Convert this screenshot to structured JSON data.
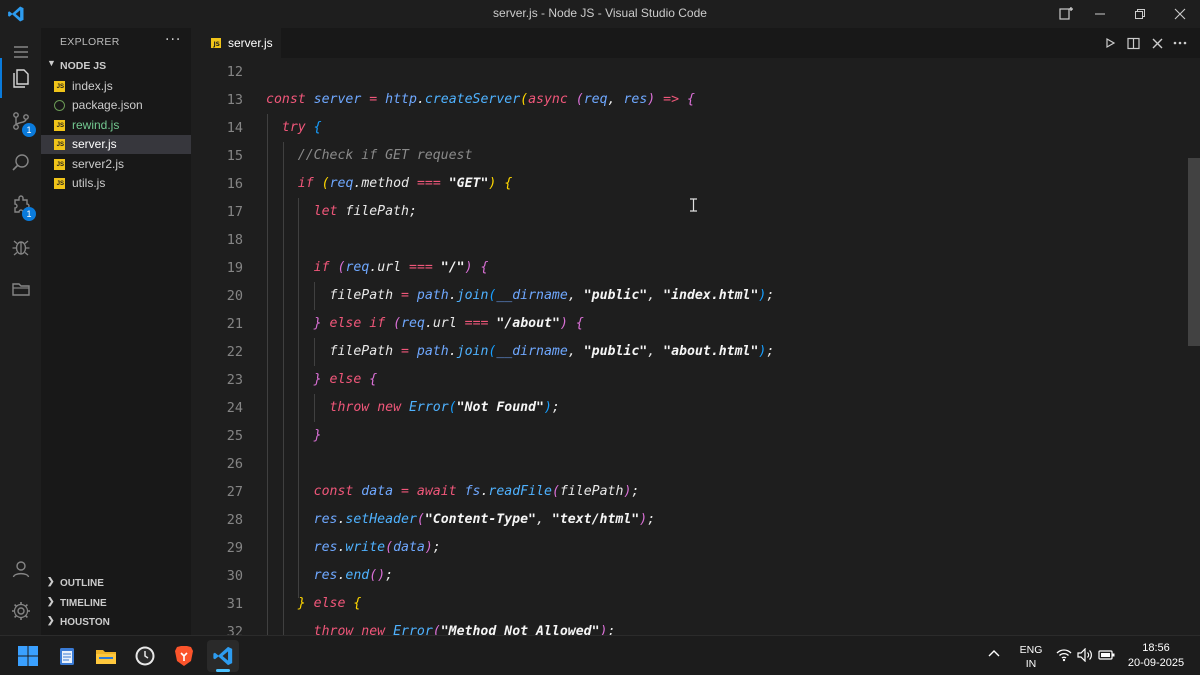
{
  "window": {
    "title": "server.js - Node JS - Visual Studio Code"
  },
  "activity_badges": {
    "scm": "1",
    "extensions": "1"
  },
  "sidebar": {
    "header": "EXPLORER",
    "more": "···",
    "folder": "NODE JS",
    "files": [
      {
        "name": "index.js",
        "icon": "js-icon",
        "color": "#cccccc"
      },
      {
        "name": "package.json",
        "icon": "json-icon",
        "color": "#cccccc"
      },
      {
        "name": "rewind.js",
        "icon": "js-icon",
        "color": "#73c991"
      },
      {
        "name": "server.js",
        "icon": "js-icon",
        "color": "#ffffff"
      },
      {
        "name": "server2.js",
        "icon": "js-icon",
        "color": "#cccccc"
      },
      {
        "name": "utils.js",
        "icon": "js-icon",
        "color": "#cccccc"
      }
    ],
    "sections": [
      "OUTLINE",
      "TIMELINE",
      "HOUSTON"
    ]
  },
  "tab": {
    "name": "server.js"
  },
  "editor": {
    "line_numbers": [
      "12",
      "13",
      "14",
      "15",
      "16",
      "17",
      "18",
      "19",
      "20",
      "21",
      "22",
      "23",
      "24",
      "25",
      "26",
      "27",
      "28",
      "29",
      "30",
      "31",
      "32"
    ]
  },
  "taskbar": {
    "language": "ENG",
    "region": "IN",
    "time": "18:56",
    "date": "20-09-2025"
  },
  "colors": {
    "accent": "#0a7bdc",
    "keyword": "#f0577a",
    "function": "#4fb2ff",
    "active_file": "#73c991"
  }
}
